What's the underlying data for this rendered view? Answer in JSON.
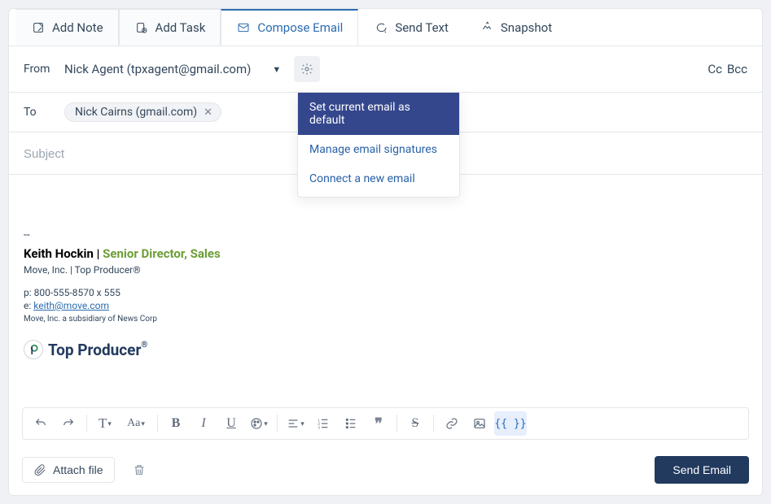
{
  "tabs": [
    {
      "id": "add-note",
      "label": "Add Note"
    },
    {
      "id": "add-task",
      "label": "Add Task"
    },
    {
      "id": "compose-email",
      "label": "Compose Email"
    },
    {
      "id": "send-text",
      "label": "Send Text"
    },
    {
      "id": "snapshot",
      "label": "Snapshot"
    }
  ],
  "active_tab": "compose-email",
  "from": {
    "label": "From",
    "value": "Nick Agent (tpxagent@gmail.com)"
  },
  "cc_label": "Cc",
  "bcc_label": "Bcc",
  "to": {
    "label": "To",
    "recipients": [
      {
        "display": "Nick Cairns (gmail.com)"
      }
    ]
  },
  "subject_placeholder": "Subject",
  "gear_menu": [
    {
      "id": "set-default",
      "label": "Set current email as default",
      "active": true
    },
    {
      "id": "manage-signatures",
      "label": "Manage email signatures",
      "active": false
    },
    {
      "id": "connect-email",
      "label": "Connect a new email",
      "active": false
    }
  ],
  "signature": {
    "separator": "--",
    "name": "Keith Hockin",
    "name_separator": " | ",
    "title": "Senior Director, Sales",
    "company": "Move, Inc. | Top Producer®",
    "phone_label": "p:  ",
    "phone": "800-555-8570 x 555",
    "email_label": "e:  ",
    "email": "keith@move.com",
    "subsidiary": "Move, Inc. a subsidiary of News Corp",
    "logo_mark": "P",
    "logo_text": "Top Producer",
    "logo_reg": "®"
  },
  "toolbar": {
    "undo": "undo",
    "redo": "redo",
    "font_style": "T",
    "font_size": "Aa",
    "bold": "B",
    "italic": "I",
    "underline": "U",
    "color": "color",
    "align": "align",
    "list_num": "1.",
    "list_bul": "•",
    "quote": "❞",
    "strike": "S",
    "link": "link",
    "image": "image",
    "merge": "{{ }}"
  },
  "footer": {
    "attach_label": "Attach file",
    "send_label": "Send Email"
  }
}
